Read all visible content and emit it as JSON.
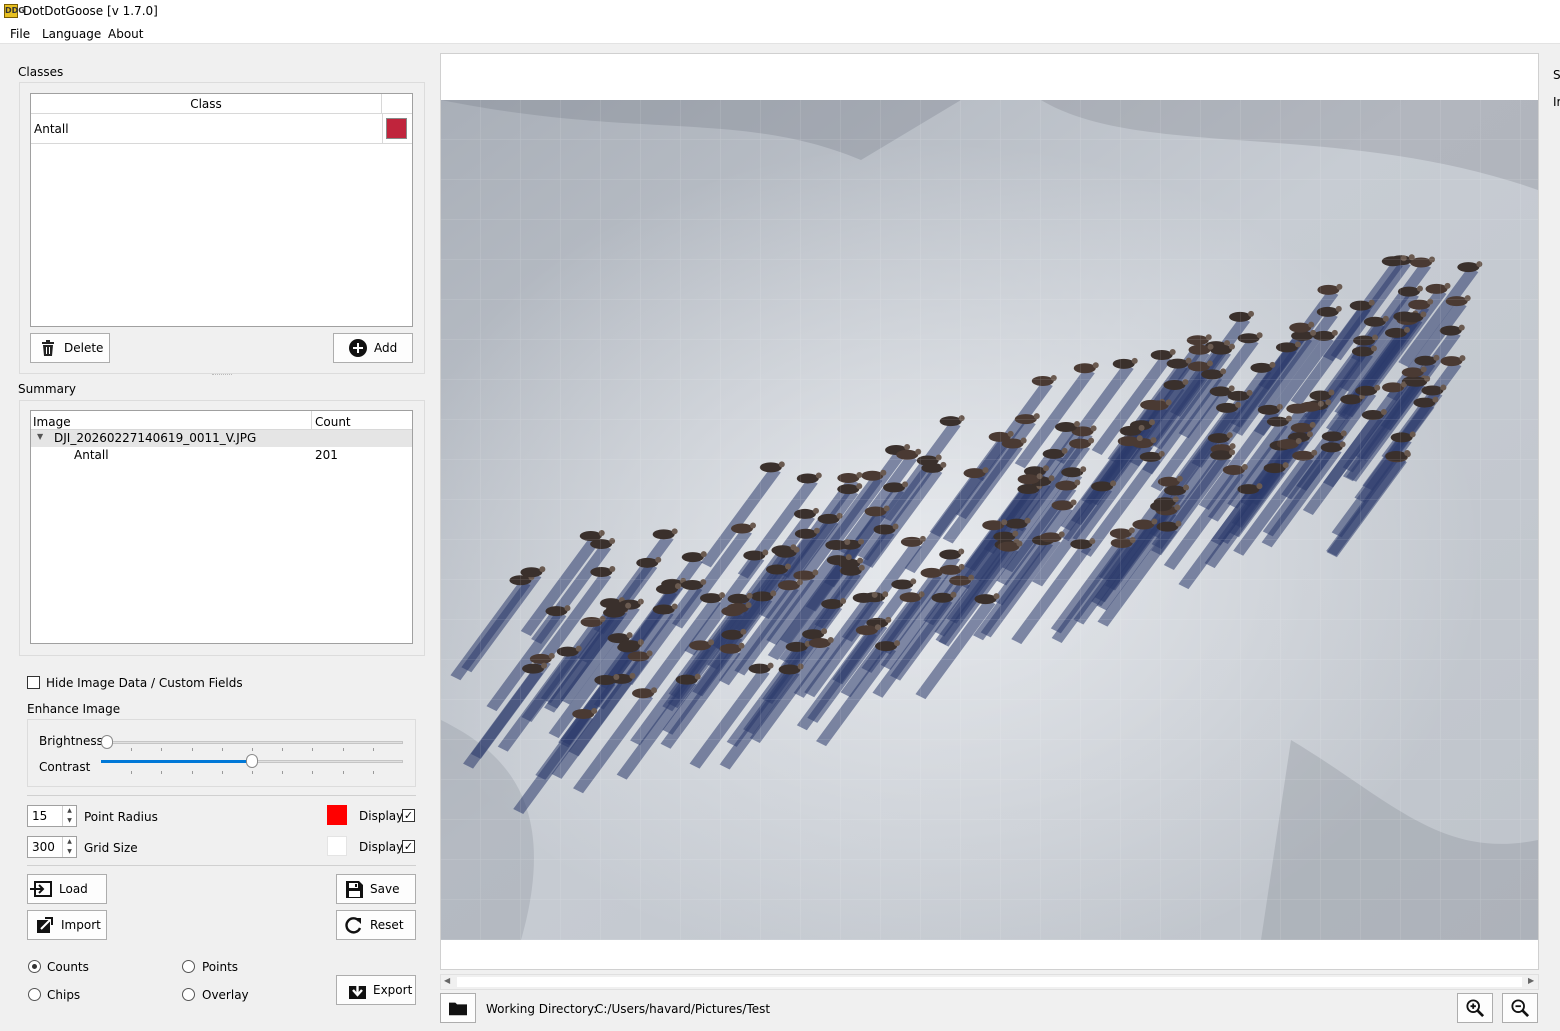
{
  "window": {
    "title": "DotDotGoose [v 1.7.0]",
    "icon_text": "DDG"
  },
  "menu": [
    "File",
    "Language",
    "About"
  ],
  "classes": {
    "label": "Classes",
    "header": "Class",
    "items": [
      {
        "name": "Antall",
        "color": "#c0243c"
      }
    ],
    "delete_label": "Delete",
    "add_label": "Add"
  },
  "summary": {
    "label": "Summary",
    "col_image": "Image",
    "col_count": "Count",
    "file": "DJI_20260227140619_0011_V.JPG",
    "rows": [
      {
        "class": "Antall",
        "count": "201"
      }
    ]
  },
  "options": {
    "hide_image_data": "Hide Image Data / Custom Fields",
    "hide_image_data_checked": false,
    "enhance_label": "Enhance Image",
    "brightness_label": "Brightness",
    "brightness_value": 0.0,
    "contrast_label": "Contrast",
    "contrast_value": 0.5,
    "point_radius_value": "15",
    "point_radius_label": "Point Radius",
    "point_color": "#ff0000",
    "point_display_label": "Display",
    "point_display_checked": true,
    "grid_size_value": "300",
    "grid_size_label": "Grid Size",
    "grid_color": "#ffffff",
    "grid_display_label": "Display",
    "grid_display_checked": true
  },
  "actions": {
    "load": "Load",
    "save": "Save",
    "import": "Import",
    "reset": "Reset",
    "export": "Export"
  },
  "export_mode": {
    "counts": "Counts",
    "points": "Points",
    "chips": "Chips",
    "overlay": "Overlay",
    "selected": "counts"
  },
  "statusbar": {
    "working_dir_label": "Working Directory:",
    "working_dir_value": "C:/Users/havard/Pictures/Test"
  },
  "right_edge_letters": [
    "S",
    "Ir"
  ]
}
